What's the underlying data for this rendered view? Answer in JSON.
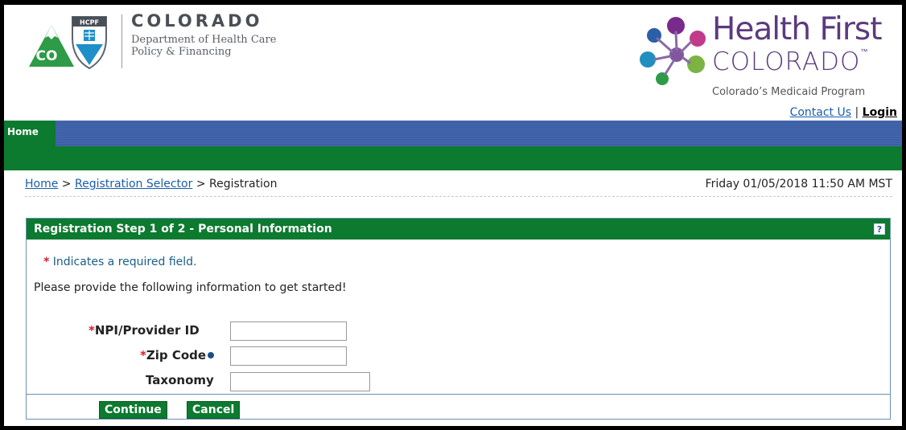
{
  "header": {
    "agency_logo_text": "HCPF",
    "agency_logo_badge": "CO",
    "state_name": "COLORADO",
    "department_line1": "Department of Health Care",
    "department_line2": "Policy & Financing",
    "program_title": "Health First",
    "program_state": "COLORADO",
    "program_tm": "™",
    "program_subtitle": "Colorado’s Medicaid Program",
    "links": {
      "contact": "Contact Us",
      "separator": "|",
      "login": "Login"
    }
  },
  "nav": {
    "home": "Home"
  },
  "breadcrumb": {
    "home": "Home",
    "sep1": ">",
    "registration_selector": "Registration Selector",
    "sep2": ">",
    "current": "Registration"
  },
  "datetime": "Friday 01/05/2018 11:50 AM MST",
  "panel": {
    "title": "Registration Step 1 of 2 - Personal Information",
    "help_label": "?",
    "required_star": "*",
    "required_note": "Indicates a required field.",
    "intro": "Please provide the following information to get started!",
    "fields": {
      "npi": {
        "star": "*",
        "label": "NPI/Provider ID",
        "value": ""
      },
      "zip": {
        "star": "*",
        "label": "Zip Code",
        "value": ""
      },
      "taxonomy": {
        "label": "Taxonomy",
        "value": ""
      }
    },
    "buttons": {
      "continue": "Continue",
      "cancel": "Cancel"
    }
  },
  "colors": {
    "green": "#0c7a2f",
    "blue": "#3c5fa7",
    "link": "#1a5ea8",
    "required": "#d0202a"
  },
  "icons": {
    "help": "help-icon",
    "info": "info-icon"
  }
}
